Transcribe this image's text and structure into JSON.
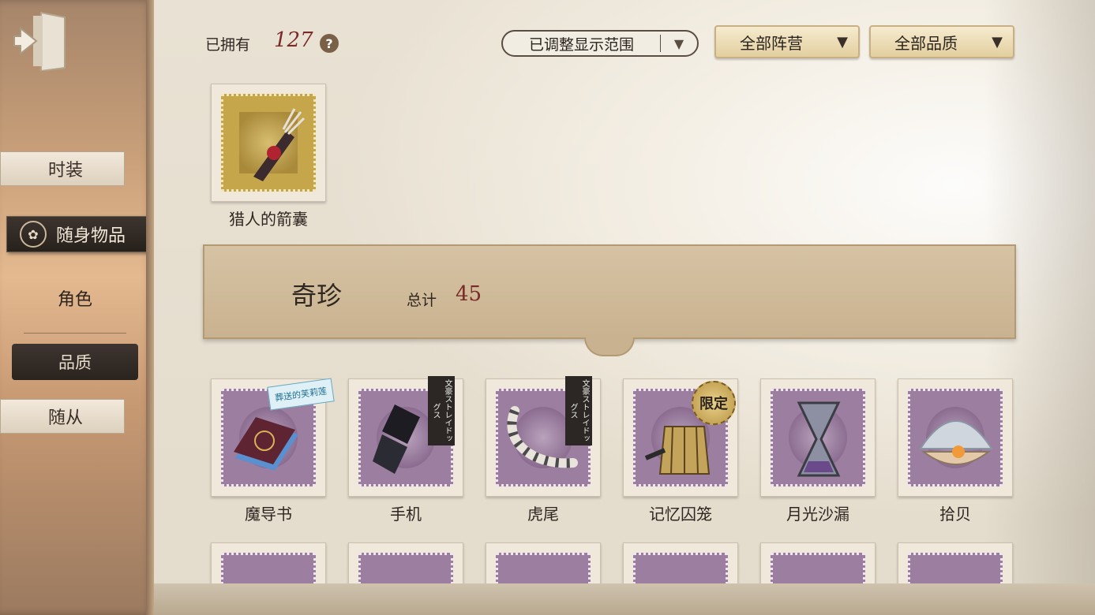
{
  "sidebar": {
    "tabs": [
      {
        "label": "时装"
      },
      {
        "label": "随身物品"
      },
      {
        "label": "随从"
      }
    ],
    "sub_label": "角色",
    "filter_label": "品质"
  },
  "header": {
    "owned_label": "已拥有",
    "owned_count": "127",
    "help_icon": "?",
    "range_select": "已调整显示范围",
    "faction_select": "全部阵营",
    "quality_select": "全部品质"
  },
  "featured_item": {
    "name": "猎人的箭囊",
    "icon": "quiver-icon"
  },
  "category": {
    "title": "奇珍",
    "total_label": "总计",
    "total_value": "45"
  },
  "items": [
    {
      "name": "魔导书",
      "icon": "grimoire-icon",
      "tag": "葬送的芙莉莲"
    },
    {
      "name": "手机",
      "icon": "flip-phone-icon",
      "ribbon": "文豪ストレイドッグス"
    },
    {
      "name": "虎尾",
      "icon": "tiger-tail-icon",
      "ribbon": "文豪ストレイドッグス"
    },
    {
      "name": "记忆囚笼",
      "icon": "cage-lamp-icon",
      "badge": "限定"
    },
    {
      "name": "月光沙漏",
      "icon": "hourglass-icon"
    },
    {
      "name": "拾贝",
      "icon": "seashell-icon"
    }
  ],
  "colors": {
    "accent_red": "#7a2a28",
    "stamp_purple": "#9b7ea0",
    "stamp_gold": "#c6a64b",
    "dark_tab": "#2a231e"
  }
}
